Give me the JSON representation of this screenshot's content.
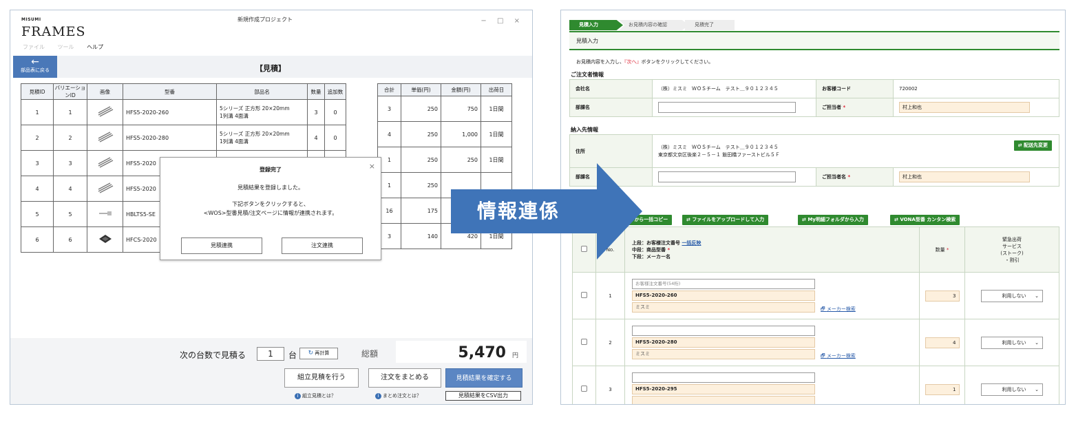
{
  "left": {
    "logo_small": "MISUMI",
    "logo_big": "FRAMES",
    "window_title": "新規作成プロジェクト",
    "window_controls": "− □ ×",
    "menu": [
      "ファイル",
      "ツール",
      "ヘルプ"
    ],
    "back_button": {
      "arrow": "←",
      "label": "部品表に戻る"
    },
    "title": "【見積】",
    "table": {
      "headers": [
        "見積ID",
        "バリエーションID",
        "画像",
        "型番",
        "部品名",
        "数量",
        "追加数",
        "合計",
        "単価(円)",
        "金額(円)",
        "出荷日"
      ],
      "rows": [
        {
          "id": "1",
          "var": "1",
          "part": "HFS5-2020-260",
          "name1": "5シリーズ 正方形 20×20mm",
          "name2": "1列溝 4面溝",
          "qty": "3",
          "add": "0",
          "sum": "3",
          "unit": "250",
          "amount": "750",
          "ship": "1日間"
        },
        {
          "id": "2",
          "var": "2",
          "part": "HFS5-2020-280",
          "name1": "5シリーズ 正方形 20×20mm",
          "name2": "1列溝 4面溝",
          "qty": "4",
          "add": "0",
          "sum": "4",
          "unit": "250",
          "amount": "1,000",
          "ship": "1日間"
        },
        {
          "id": "3",
          "var": "3",
          "part": "HFS5-2020",
          "name1": "",
          "name2": "",
          "qty": "",
          "add": "",
          "sum": "1",
          "unit": "250",
          "amount": "250",
          "ship": "1日間"
        },
        {
          "id": "4",
          "var": "4",
          "part": "HFS5-2020",
          "name1": "",
          "name2": "",
          "qty": "",
          "add": "",
          "sum": "1",
          "unit": "250",
          "amount": "",
          "ship": ""
        },
        {
          "id": "5",
          "var": "5",
          "part": "HBLTS5-SE",
          "name1": "",
          "name2": "",
          "qty": "",
          "add": "",
          "sum": "16",
          "unit": "175",
          "amount": "",
          "ship": ""
        },
        {
          "id": "6",
          "var": "6",
          "part": "HFCS-2020",
          "name1": "",
          "name2": "",
          "qty": "",
          "add": "",
          "sum": "3",
          "unit": "140",
          "amount": "420",
          "ship": "1日間"
        }
      ]
    },
    "modal": {
      "title": "登録完了",
      "close": "×",
      "message1": "見積結果を登録しました。",
      "message2": "下記ボタンをクリックすると、",
      "message3": "<WOS>型番見積/注文ページに情報が連携されます。",
      "btn_quote": "見積連携",
      "btn_order": "注文連携"
    },
    "footer": {
      "qty_label": "次の台数で見積る",
      "qty_value": "1",
      "qty_unit": "台",
      "recalc_icon": "↻",
      "recalc": "再計算",
      "total_label": "総額",
      "total_value": "5,470",
      "total_unit": "円",
      "btn_assembly": "組立見積を行う",
      "btn_combine": "注文をまとめる",
      "btn_confirm": "見積結果を確定する",
      "help_icon": "i",
      "help_assembly": "組立見積とは？",
      "help_combine": "まとめ注文とは？",
      "btn_csv": "見積結果をCSV出力"
    }
  },
  "arrow": {
    "label": "情報連係",
    "color": "#3f74b8"
  },
  "right": {
    "steps": [
      "見積入力",
      "お見積内容の確認",
      "見積完了"
    ],
    "section_title": "見積入力",
    "instruction_pre": "お見積内容を入力し、",
    "instruction_red": "『次へ』",
    "instruction_post": "ボタンをクリックしてください。",
    "orderer_heading": "ご注文者情報",
    "orderer": {
      "company_label": "会社名",
      "company_value": "（株）ミスミ　ＷＯＳチーム　テスト＿９０１２３４５",
      "code_label": "お客様コード",
      "code_value": "720002",
      "dept_label": "部課名",
      "person_label": "ご担当者",
      "person_value": "村上和也"
    },
    "delivery_heading": "納入先情報",
    "delivery": {
      "addr_label": "住所",
      "addr_line1": "（株）ミスミ　ＷＯＳチーム　テスト＿９０１２３４５",
      "addr_line2": "東京都文京区後楽２－５－１ 飯田橋ファーストビル５Ｆ",
      "change_btn": "配送先変更",
      "dept_label": "部課名",
      "person_label": "ご担当者名",
      "person_value": "村上和也"
    },
    "action_buttons": [
      "から一括コピー",
      "ファイルをアップロードして入力",
      "My明細フォルダから入力",
      "VONA型番 カンタン検索"
    ],
    "parts_header": {
      "no": "No.",
      "desc1": "上段：お客様注文番号",
      "desc1_link": "一括反映",
      "desc2": "中段：商品型番",
      "desc3": "下段：メーカー名",
      "qty": "数量",
      "service1": "緊急出荷",
      "service2": "サービス",
      "service3": "(ストーク)",
      "service4": "・割引"
    },
    "parts_rows": [
      {
        "no": "1",
        "order_placeholder": "お客様注文番号(54桁)",
        "part": "HFS5-2020-260",
        "maker": "ミスミ",
        "maker_link": "メーカー検索",
        "qty": "3",
        "service": "利用しない"
      },
      {
        "no": "2",
        "order_placeholder": "",
        "part": "HFS5-2020-280",
        "maker": "ミスミ",
        "maker_link": "メーカー検索",
        "qty": "4",
        "service": "利用しない"
      },
      {
        "no": "3",
        "order_placeholder": "",
        "part": "HFS5-2020-295",
        "maker": "",
        "maker_link": "",
        "qty": "1",
        "service": "利用しない"
      }
    ]
  }
}
